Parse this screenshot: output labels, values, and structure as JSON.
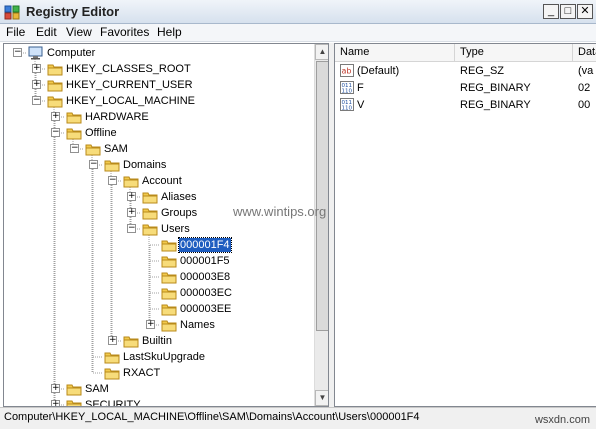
{
  "window": {
    "title": "Registry Editor",
    "minimize": "_",
    "maximize": "□",
    "close": "✕"
  },
  "menu": [
    "File",
    "Edit",
    "View",
    "Favorites",
    "Help"
  ],
  "tree": [
    {
      "label": "Computer",
      "level": 0,
      "expander": "minus",
      "icon": "computer-icon"
    },
    {
      "label": "HKEY_CLASSES_ROOT",
      "level": 1,
      "expander": "plus",
      "icon": "folder-icon"
    },
    {
      "label": "HKEY_CURRENT_USER",
      "level": 1,
      "expander": "plus",
      "icon": "folder-icon"
    },
    {
      "label": "HKEY_LOCAL_MACHINE",
      "level": 1,
      "expander": "minus",
      "icon": "folder-icon"
    },
    {
      "label": "HARDWARE",
      "level": 2,
      "expander": "plus",
      "icon": "folder-icon"
    },
    {
      "label": "Offline",
      "level": 2,
      "expander": "minus",
      "icon": "folder-icon"
    },
    {
      "label": "SAM",
      "level": 3,
      "expander": "minus",
      "icon": "folder-icon"
    },
    {
      "label": "Domains",
      "level": 4,
      "expander": "minus",
      "icon": "folder-icon"
    },
    {
      "label": "Account",
      "level": 5,
      "expander": "minus",
      "icon": "folder-icon"
    },
    {
      "label": "Aliases",
      "level": 6,
      "expander": "plus",
      "icon": "folder-icon"
    },
    {
      "label": "Groups",
      "level": 6,
      "expander": "plus",
      "icon": "folder-icon"
    },
    {
      "label": "Users",
      "level": 6,
      "expander": "minus",
      "icon": "folder-icon"
    },
    {
      "label": "000001F4",
      "level": 7,
      "expander": "none",
      "icon": "folder-icon",
      "selected": true
    },
    {
      "label": "000001F5",
      "level": 7,
      "expander": "none",
      "icon": "folder-icon"
    },
    {
      "label": "000003E8",
      "level": 7,
      "expander": "none",
      "icon": "folder-icon"
    },
    {
      "label": "000003EC",
      "level": 7,
      "expander": "none",
      "icon": "folder-icon"
    },
    {
      "label": "000003EE",
      "level": 7,
      "expander": "none",
      "icon": "folder-icon"
    },
    {
      "label": "Names",
      "level": 7,
      "expander": "plus",
      "icon": "folder-icon"
    },
    {
      "label": "Builtin",
      "level": 5,
      "expander": "plus",
      "icon": "folder-icon"
    },
    {
      "label": "LastSkuUpgrade",
      "level": 4,
      "expander": "none",
      "icon": "folder-icon"
    },
    {
      "label": "RXACT",
      "level": 4,
      "expander": "none",
      "icon": "folder-icon"
    },
    {
      "label": "SAM",
      "level": 2,
      "expander": "plus",
      "icon": "folder-icon"
    },
    {
      "label": "SECURITY",
      "level": 2,
      "expander": "plus",
      "icon": "folder-icon"
    }
  ],
  "columns": [
    "Name",
    "Type",
    "Data"
  ],
  "values": [
    {
      "name": "(Default)",
      "type": "REG_SZ",
      "data": "(va",
      "icon": "string-value-icon"
    },
    {
      "name": "F",
      "type": "REG_BINARY",
      "data": "02",
      "icon": "binary-value-icon"
    },
    {
      "name": "V",
      "type": "REG_BINARY",
      "data": "00",
      "icon": "binary-value-icon"
    }
  ],
  "status": "Computer\\HKEY_LOCAL_MACHINE\\Offline\\SAM\\Domains\\Account\\Users\\000001F4",
  "watermarks": {
    "center": "www.wintips.org",
    "corner": "wsxdn.com"
  },
  "colors": {
    "selection": "#1e5dc0",
    "folder": "#f2c94c",
    "titlebar": "#d6e1ee"
  }
}
